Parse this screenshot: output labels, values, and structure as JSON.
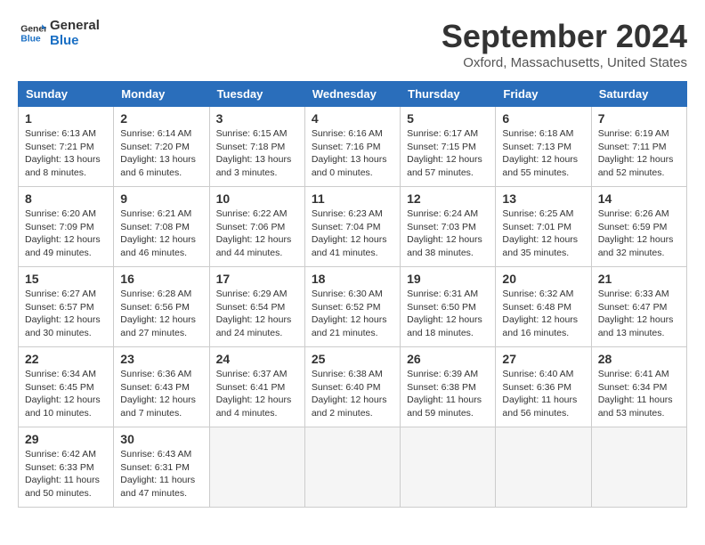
{
  "logo": {
    "line1": "General",
    "line2": "Blue"
  },
  "title": "September 2024",
  "location": "Oxford, Massachusetts, United States",
  "days_of_week": [
    "Sunday",
    "Monday",
    "Tuesday",
    "Wednesday",
    "Thursday",
    "Friday",
    "Saturday"
  ],
  "weeks": [
    [
      {
        "num": "1",
        "info": "Sunrise: 6:13 AM\nSunset: 7:21 PM\nDaylight: 13 hours\nand 8 minutes."
      },
      {
        "num": "2",
        "info": "Sunrise: 6:14 AM\nSunset: 7:20 PM\nDaylight: 13 hours\nand 6 minutes."
      },
      {
        "num": "3",
        "info": "Sunrise: 6:15 AM\nSunset: 7:18 PM\nDaylight: 13 hours\nand 3 minutes."
      },
      {
        "num": "4",
        "info": "Sunrise: 6:16 AM\nSunset: 7:16 PM\nDaylight: 13 hours\nand 0 minutes."
      },
      {
        "num": "5",
        "info": "Sunrise: 6:17 AM\nSunset: 7:15 PM\nDaylight: 12 hours\nand 57 minutes."
      },
      {
        "num": "6",
        "info": "Sunrise: 6:18 AM\nSunset: 7:13 PM\nDaylight: 12 hours\nand 55 minutes."
      },
      {
        "num": "7",
        "info": "Sunrise: 6:19 AM\nSunset: 7:11 PM\nDaylight: 12 hours\nand 52 minutes."
      }
    ],
    [
      {
        "num": "8",
        "info": "Sunrise: 6:20 AM\nSunset: 7:09 PM\nDaylight: 12 hours\nand 49 minutes."
      },
      {
        "num": "9",
        "info": "Sunrise: 6:21 AM\nSunset: 7:08 PM\nDaylight: 12 hours\nand 46 minutes."
      },
      {
        "num": "10",
        "info": "Sunrise: 6:22 AM\nSunset: 7:06 PM\nDaylight: 12 hours\nand 44 minutes."
      },
      {
        "num": "11",
        "info": "Sunrise: 6:23 AM\nSunset: 7:04 PM\nDaylight: 12 hours\nand 41 minutes."
      },
      {
        "num": "12",
        "info": "Sunrise: 6:24 AM\nSunset: 7:03 PM\nDaylight: 12 hours\nand 38 minutes."
      },
      {
        "num": "13",
        "info": "Sunrise: 6:25 AM\nSunset: 7:01 PM\nDaylight: 12 hours\nand 35 minutes."
      },
      {
        "num": "14",
        "info": "Sunrise: 6:26 AM\nSunset: 6:59 PM\nDaylight: 12 hours\nand 32 minutes."
      }
    ],
    [
      {
        "num": "15",
        "info": "Sunrise: 6:27 AM\nSunset: 6:57 PM\nDaylight: 12 hours\nand 30 minutes."
      },
      {
        "num": "16",
        "info": "Sunrise: 6:28 AM\nSunset: 6:56 PM\nDaylight: 12 hours\nand 27 minutes."
      },
      {
        "num": "17",
        "info": "Sunrise: 6:29 AM\nSunset: 6:54 PM\nDaylight: 12 hours\nand 24 minutes."
      },
      {
        "num": "18",
        "info": "Sunrise: 6:30 AM\nSunset: 6:52 PM\nDaylight: 12 hours\nand 21 minutes."
      },
      {
        "num": "19",
        "info": "Sunrise: 6:31 AM\nSunset: 6:50 PM\nDaylight: 12 hours\nand 18 minutes."
      },
      {
        "num": "20",
        "info": "Sunrise: 6:32 AM\nSunset: 6:48 PM\nDaylight: 12 hours\nand 16 minutes."
      },
      {
        "num": "21",
        "info": "Sunrise: 6:33 AM\nSunset: 6:47 PM\nDaylight: 12 hours\nand 13 minutes."
      }
    ],
    [
      {
        "num": "22",
        "info": "Sunrise: 6:34 AM\nSunset: 6:45 PM\nDaylight: 12 hours\nand 10 minutes."
      },
      {
        "num": "23",
        "info": "Sunrise: 6:36 AM\nSunset: 6:43 PM\nDaylight: 12 hours\nand 7 minutes."
      },
      {
        "num": "24",
        "info": "Sunrise: 6:37 AM\nSunset: 6:41 PM\nDaylight: 12 hours\nand 4 minutes."
      },
      {
        "num": "25",
        "info": "Sunrise: 6:38 AM\nSunset: 6:40 PM\nDaylight: 12 hours\nand 2 minutes."
      },
      {
        "num": "26",
        "info": "Sunrise: 6:39 AM\nSunset: 6:38 PM\nDaylight: 11 hours\nand 59 minutes."
      },
      {
        "num": "27",
        "info": "Sunrise: 6:40 AM\nSunset: 6:36 PM\nDaylight: 11 hours\nand 56 minutes."
      },
      {
        "num": "28",
        "info": "Sunrise: 6:41 AM\nSunset: 6:34 PM\nDaylight: 11 hours\nand 53 minutes."
      }
    ],
    [
      {
        "num": "29",
        "info": "Sunrise: 6:42 AM\nSunset: 6:33 PM\nDaylight: 11 hours\nand 50 minutes."
      },
      {
        "num": "30",
        "info": "Sunrise: 6:43 AM\nSunset: 6:31 PM\nDaylight: 11 hours\nand 47 minutes."
      },
      {
        "num": "",
        "info": ""
      },
      {
        "num": "",
        "info": ""
      },
      {
        "num": "",
        "info": ""
      },
      {
        "num": "",
        "info": ""
      },
      {
        "num": "",
        "info": ""
      }
    ]
  ]
}
